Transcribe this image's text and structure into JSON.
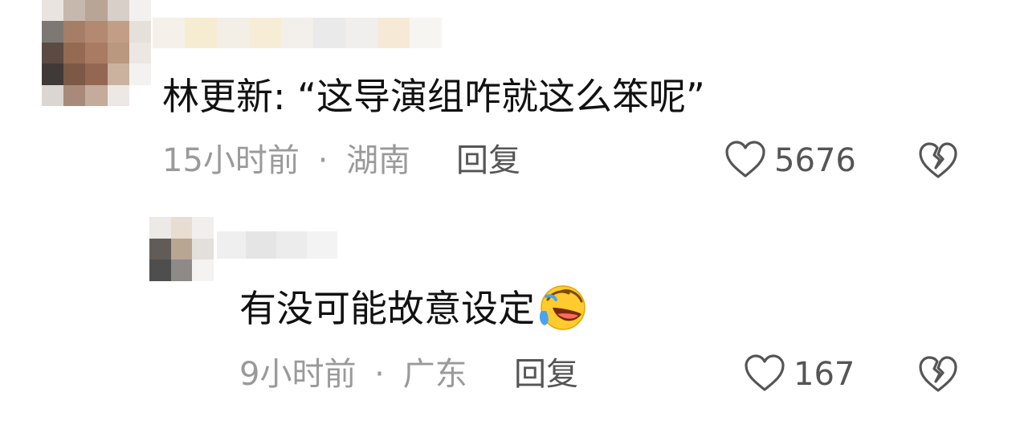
{
  "comments": [
    {
      "author_display": "林更新",
      "text": "“这导演组咋就这么笨呢”",
      "time": "15小时前",
      "sep": "·",
      "location": "湖南",
      "reply_label": "回复",
      "likes": "5676"
    },
    {
      "text": "有没可能故意设定",
      "emoji": "laughing-crying-emoji",
      "time": "9小时前",
      "sep": "·",
      "location": "广东",
      "reply_label": "回复",
      "likes": "167"
    }
  ],
  "icons": {
    "like": "heart-outline-icon",
    "dislike": "broken-heart-icon"
  },
  "colors": {
    "text_primary": "#111111",
    "meta_gray": "#9a9a9a",
    "action_gray": "#555555"
  }
}
